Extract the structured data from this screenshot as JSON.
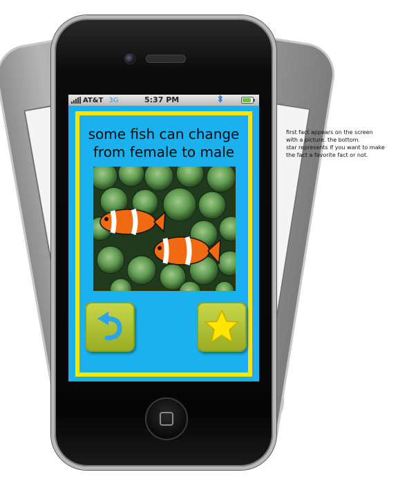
{
  "statusbar": {
    "carrier": "AT&T",
    "network": "3G",
    "time": "5:37 PM",
    "bluetooth_icon": "bluetooth-icon",
    "battery_level": 0.85
  },
  "fact": {
    "line1": "some fish can change",
    "line2": "from female to male",
    "image_subject": "clownfish among sea anemones"
  },
  "buttons": {
    "back_icon": "undo-arrow-icon",
    "favorite_icon": "star-icon"
  },
  "annotation": {
    "line1": "first fact appears on the screen",
    "line2": "with a picture. the bottom.",
    "line3": "star represents if you want to make",
    "line4": "the fact a favorite fact or not."
  },
  "colors": {
    "screen_bg": "#1ab1ee",
    "card_border": "#ffe600",
    "button_green": "#b3c635",
    "star_yellow": "#ffe600",
    "arrow_blue": "#2aa6e8"
  }
}
